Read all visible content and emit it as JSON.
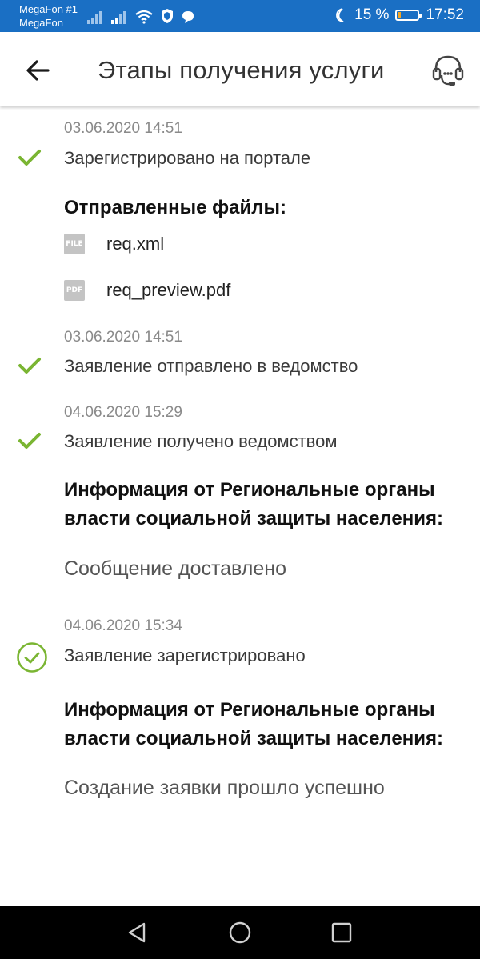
{
  "status_bar": {
    "carrier_line1": "MegaFon #1",
    "carrier_line2": "MegaFon",
    "battery_text": "15 %",
    "battery_level": 0.15,
    "time": "17:52",
    "icons": [
      "signal-icon",
      "signal-icon",
      "wifi-icon",
      "shield-icon",
      "chat-icon",
      "moon-icon",
      "battery-icon"
    ]
  },
  "header": {
    "title": "Этапы получения услуги",
    "back_icon": "arrow-left-icon",
    "support_icon": "headset-icon"
  },
  "timeline": {
    "step1": {
      "date": "03.06.2020 14:51",
      "status": "Зарегистрировано на портале",
      "files_heading": "Отправленные файлы:",
      "files": [
        {
          "type_label": "FILE",
          "name": "req.xml"
        },
        {
          "type_label": "PDF",
          "name": "req_preview.pdf"
        }
      ]
    },
    "step2": {
      "date": "03.06.2020 14:51",
      "status": "Заявление отправлено в ведомство"
    },
    "step3": {
      "date": "04.06.2020 15:29",
      "status": "Заявление получено ведомством",
      "info_heading": "Информация от Региональные органы власти социальной защиты населения:",
      "info_message": "Сообщение доставлено"
    },
    "step4": {
      "date": "04.06.2020 15:34",
      "status": "Заявление зарегистрировано",
      "info_heading": "Информация от Региональные органы власти социальной защиты населения:",
      "info_message": "Создание заявки прошло успешно"
    }
  },
  "colors": {
    "status_bar": "#1a6fc4",
    "check_green": "#7ab532",
    "nav_bar": "#000000"
  },
  "nav_bar": {
    "icons": [
      "back-triangle-icon",
      "home-circle-icon",
      "recents-square-icon"
    ]
  }
}
